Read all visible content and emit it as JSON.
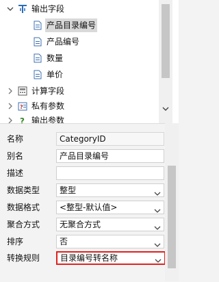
{
  "tree": {
    "items": [
      {
        "label": "输出字段",
        "expanded": true,
        "icon": "output-field-icon"
      },
      {
        "label": "产品目录编号",
        "selected": true,
        "icon": "field-icon"
      },
      {
        "label": "产品编号",
        "icon": "field-icon"
      },
      {
        "label": "数量",
        "icon": "field-icon"
      },
      {
        "label": "单价",
        "icon": "field-icon"
      },
      {
        "label": "计算字段",
        "expanded": false,
        "icon": "calc-field-icon"
      },
      {
        "label": "私有参数",
        "expanded": false,
        "icon": "private-param-icon"
      },
      {
        "label": "输出参数",
        "expanded": false,
        "icon": "output-param-icon"
      }
    ]
  },
  "properties": {
    "rows": [
      {
        "label": "名称",
        "value": "CategoryID",
        "type": "readonly"
      },
      {
        "label": "别名",
        "value": "产品目录编号",
        "type": "text"
      },
      {
        "label": "描述",
        "value": "",
        "type": "text"
      },
      {
        "label": "数据类型",
        "value": "整型",
        "type": "select"
      },
      {
        "label": "数据格式",
        "value": "<整型-默认值>",
        "type": "select"
      },
      {
        "label": "聚合方式",
        "value": "无聚合方式",
        "type": "select"
      },
      {
        "label": "排序",
        "value": "否",
        "type": "select"
      },
      {
        "label": "转换规则",
        "value": "目录编号转名称",
        "type": "select",
        "highlighted": true
      }
    ]
  },
  "colors": {
    "highlight": "#e02020",
    "selection": "#d9d9d9"
  }
}
